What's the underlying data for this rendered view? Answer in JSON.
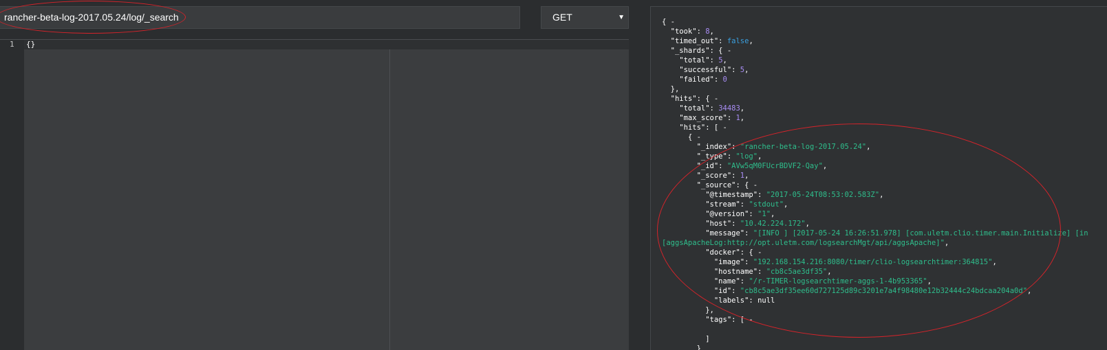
{
  "request": {
    "url": "rancher-beta-log-2017.05.24/log/_search",
    "method": "GET",
    "method_caret": "▼"
  },
  "editor": {
    "line_number": "1",
    "code": "{}"
  },
  "response_lines": [
    [
      [
        "{ -",
        "k"
      ]
    ],
    [
      [
        "  \"took\": ",
        "k"
      ],
      [
        "8",
        "n"
      ],
      [
        ",",
        "k"
      ]
    ],
    [
      [
        "  \"timed_out\": ",
        "k"
      ],
      [
        "false",
        "b"
      ],
      [
        ",",
        "k"
      ]
    ],
    [
      [
        "  \"_shards\": { -",
        "k"
      ]
    ],
    [
      [
        "    \"total\": ",
        "k"
      ],
      [
        "5",
        "n"
      ],
      [
        ",",
        "k"
      ]
    ],
    [
      [
        "    \"successful\": ",
        "k"
      ],
      [
        "5",
        "n"
      ],
      [
        ",",
        "k"
      ]
    ],
    [
      [
        "    \"failed\": ",
        "k"
      ],
      [
        "0",
        "n"
      ]
    ],
    [
      [
        "  },",
        "k"
      ]
    ],
    [
      [
        "  \"hits\": { -",
        "k"
      ]
    ],
    [
      [
        "    \"total\": ",
        "k"
      ],
      [
        "34483",
        "n"
      ],
      [
        ",",
        "k"
      ]
    ],
    [
      [
        "    \"max_score\": ",
        "k"
      ],
      [
        "1",
        "n"
      ],
      [
        ",",
        "k"
      ]
    ],
    [
      [
        "    \"hits\": [ -",
        "k"
      ]
    ],
    [
      [
        "      { -",
        "k"
      ]
    ],
    [
      [
        "        \"_index\": ",
        "k"
      ],
      [
        "\"rancher-beta-log-2017.05.24\"",
        "s"
      ],
      [
        ",",
        "k"
      ]
    ],
    [
      [
        "        \"_type\": ",
        "k"
      ],
      [
        "\"log\"",
        "s"
      ],
      [
        ",",
        "k"
      ]
    ],
    [
      [
        "        \"_id\": ",
        "k"
      ],
      [
        "\"AVw5qM0FUcrBDVF2-Qay\"",
        "s"
      ],
      [
        ",",
        "k"
      ]
    ],
    [
      [
        "        \"_score\": ",
        "k"
      ],
      [
        "1",
        "n"
      ],
      [
        ",",
        "k"
      ]
    ],
    [
      [
        "        \"_source\": { -",
        "k"
      ]
    ],
    [
      [
        "          \"@timestamp\": ",
        "k"
      ],
      [
        "\"2017-05-24T08:53:02.583Z\"",
        "s"
      ],
      [
        ",",
        "k"
      ]
    ],
    [
      [
        "          \"stream\": ",
        "k"
      ],
      [
        "\"stdout\"",
        "s"
      ],
      [
        ",",
        "k"
      ]
    ],
    [
      [
        "          \"@version\": ",
        "k"
      ],
      [
        "\"1\"",
        "s"
      ],
      [
        ",",
        "k"
      ]
    ],
    [
      [
        "          \"host\": ",
        "k"
      ],
      [
        "\"10.42.224.172\"",
        "s"
      ],
      [
        ",",
        "k"
      ]
    ],
    [
      [
        "          \"message\": ",
        "k"
      ],
      [
        "\"[INFO ] [2017-05-24 16:26:51.978] [com.uletm.clio.timer.main.Initialize] [in",
        "s"
      ]
    ],
    [
      [
        "[aggsApacheLog:http://opt.uletm.com/logsearchMgt/api/aggsApache]\"",
        "s"
      ],
      [
        ",",
        "k"
      ]
    ],
    [
      [
        "          \"docker\": { -",
        "k"
      ]
    ],
    [
      [
        "            \"image\": ",
        "k"
      ],
      [
        "\"192.168.154.216:8080/timer/clio-logsearchtimer:364815\"",
        "s"
      ],
      [
        ",",
        "k"
      ]
    ],
    [
      [
        "            \"hostname\": ",
        "k"
      ],
      [
        "\"cb8c5ae3df35\"",
        "s"
      ],
      [
        ",",
        "k"
      ]
    ],
    [
      [
        "            \"name\": ",
        "k"
      ],
      [
        "\"/r-TIMER-logsearchtimer-aggs-1-4b953365\"",
        "s"
      ],
      [
        ",",
        "k"
      ]
    ],
    [
      [
        "            \"id\": ",
        "k"
      ],
      [
        "\"cb8c5ae3df35ee60d727125d89c3201e7a4f98480e12b32444c24bdcaa204a0d\"",
        "s"
      ],
      [
        ",",
        "k"
      ]
    ],
    [
      [
        "            \"labels\": null",
        "k"
      ]
    ],
    [
      [
        "          },",
        "k"
      ]
    ],
    [
      [
        "          \"tags\": [ -",
        "k"
      ]
    ],
    [
      [
        "",
        "k"
      ]
    ],
    [
      [
        "          ]",
        "k"
      ]
    ],
    [
      [
        "        }",
        "k"
      ]
    ]
  ]
}
